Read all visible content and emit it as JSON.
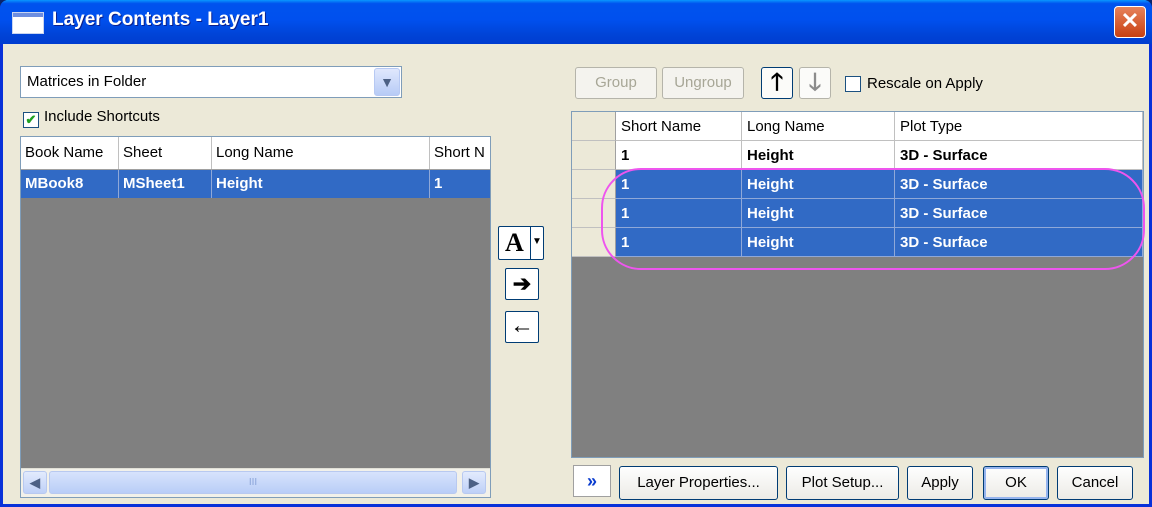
{
  "window": {
    "title": "Layer Contents - Layer1",
    "close_glyph": "✕"
  },
  "source": {
    "selected": "Matrices in Folder",
    "include_shortcuts_label": "Include Shortcuts",
    "include_shortcuts_checked": true,
    "columns": [
      "Book Name",
      "Sheet",
      "Long Name",
      "Short N"
    ],
    "rows": [
      {
        "book": "MBook8",
        "sheet": "MSheet1",
        "long": "Height",
        "short": "1"
      }
    ],
    "scroll_grip": "III"
  },
  "middle": {
    "font_btn": "A",
    "add_glyph": "➔",
    "remove_glyph": "←"
  },
  "toolbar": {
    "group": "Group",
    "ungroup": "Ungroup",
    "up_glyph": "🡑",
    "down_glyph": "🡓",
    "rescale_label": "Rescale on Apply",
    "rescale_checked": false
  },
  "layer": {
    "columns": [
      "Short Name",
      "Long Name",
      "Plot Type"
    ],
    "rows": [
      {
        "short": "1",
        "long": "Height",
        "plot": "3D - Surface",
        "selected": false
      },
      {
        "short": "1",
        "long": "Height",
        "plot": "3D - Surface",
        "selected": true
      },
      {
        "short": "1",
        "long": "Height",
        "plot": "3D - Surface",
        "selected": true
      },
      {
        "short": "1",
        "long": "Height",
        "plot": "3D - Surface",
        "selected": true
      }
    ]
  },
  "buttons": {
    "expand": "»",
    "layer_properties": "Layer Properties...",
    "plot_setup": "Plot Setup...",
    "apply": "Apply",
    "ok": "OK",
    "cancel": "Cancel"
  },
  "colors": {
    "title_bar": "#0050ee",
    "selection": "#316ac5",
    "highlight_ring": "#ee55ee",
    "grid_bg": "#808080"
  }
}
